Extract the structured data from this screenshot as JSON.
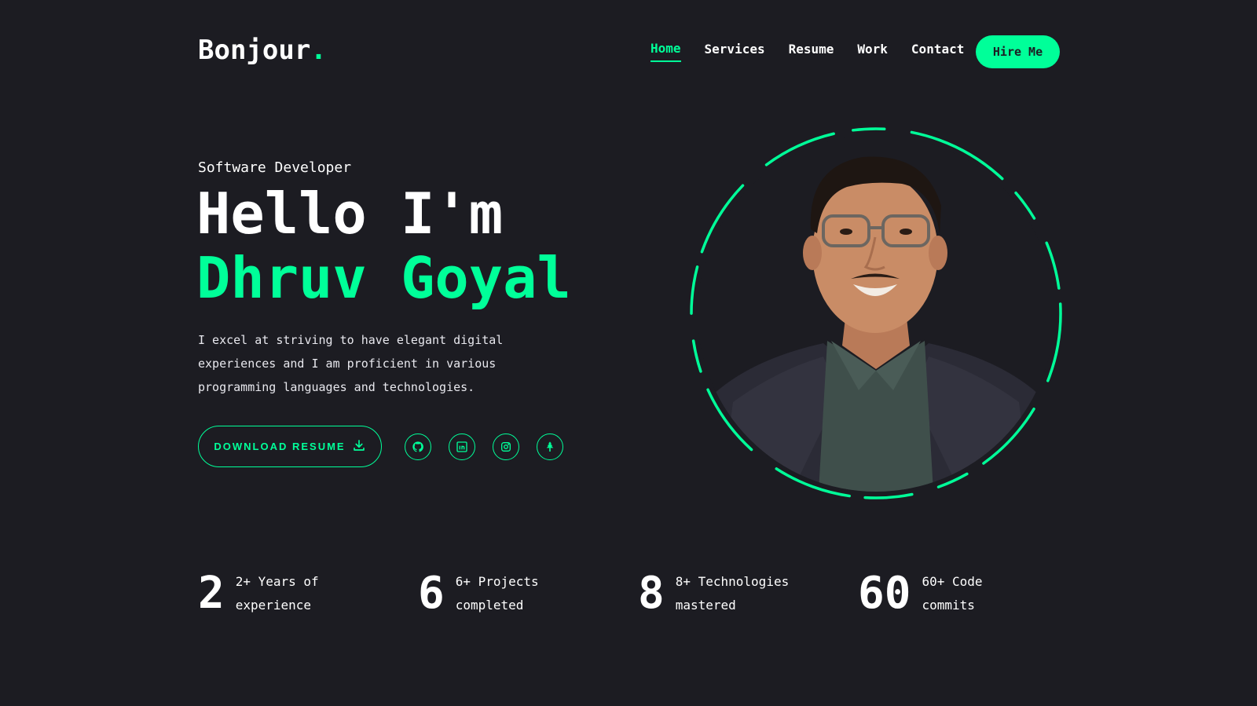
{
  "header": {
    "logo_text": "Bonjour",
    "logo_dot": ".",
    "nav": [
      {
        "label": "Home",
        "active": true
      },
      {
        "label": "Services"
      },
      {
        "label": "Resume"
      },
      {
        "label": "Work"
      },
      {
        "label": "Contact"
      }
    ],
    "hire_label": "Hire Me"
  },
  "hero": {
    "role": "Software Developer",
    "greeting": "Hello I'm",
    "name": "Dhruv Goyal",
    "bio": "I excel at striving to have elegant digital experiences and I am proficient in various programming languages and technologies.",
    "download_label": "DOWNLOAD RESUME",
    "socials": [
      {
        "icon": "github-icon"
      },
      {
        "icon": "linkedin-icon"
      },
      {
        "icon": "instagram-icon"
      },
      {
        "icon": "linktree-icon"
      }
    ]
  },
  "stats": [
    {
      "number": "2",
      "label": "2+ Years of experience"
    },
    {
      "number": "6",
      "label": "6+ Projects completed"
    },
    {
      "number": "8",
      "label": "8+ Technologies mastered"
    },
    {
      "number": "60",
      "label": "60+ Code commits"
    }
  ],
  "colors": {
    "background": "#1c1c22",
    "accent": "#00ff99",
    "text": "#ffffff"
  }
}
